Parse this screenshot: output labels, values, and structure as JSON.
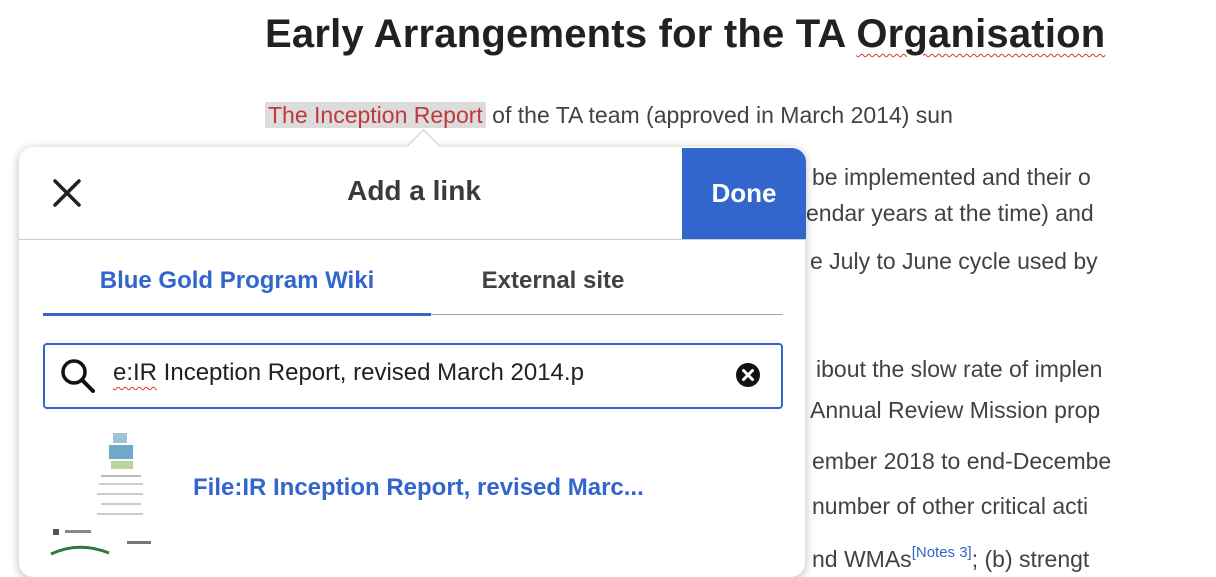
{
  "article": {
    "heading_part1": "Early Arrangements for the TA ",
    "heading_part2": "Organisation",
    "selected_link": "The Inception Report",
    "line1_rest": " of the TA team (approved in March 2014) sun",
    "lines": [
      "be implemented and their o",
      "endar years at the time) and",
      "e July to June cycle used by",
      "ibout the slow rate of implen",
      "Annual Review Mission prop",
      "ember 2018 to end-Decembe",
      "number of other critical acti"
    ],
    "last_line_start": "nd WMAs",
    "note": "[Notes 3]",
    "last_line_end": "; (b) strengt"
  },
  "dialog": {
    "close_icon": "close-icon",
    "title": "Add a link",
    "done_label": "Done",
    "tabs": [
      {
        "label": "Blue Gold Program Wiki",
        "active": true
      },
      {
        "label": "External site",
        "active": false
      }
    ],
    "search": {
      "icon": "search-icon",
      "value_spell": "e:IR",
      "value_rest": " Inception Report, revised March 2014.p",
      "clear_icon": "clear-icon"
    },
    "result": {
      "label": "File:IR Inception Report, revised Marc..."
    }
  },
  "colors": {
    "accent": "#3366cc",
    "link_red": "#c0393b",
    "text": "#202122"
  }
}
